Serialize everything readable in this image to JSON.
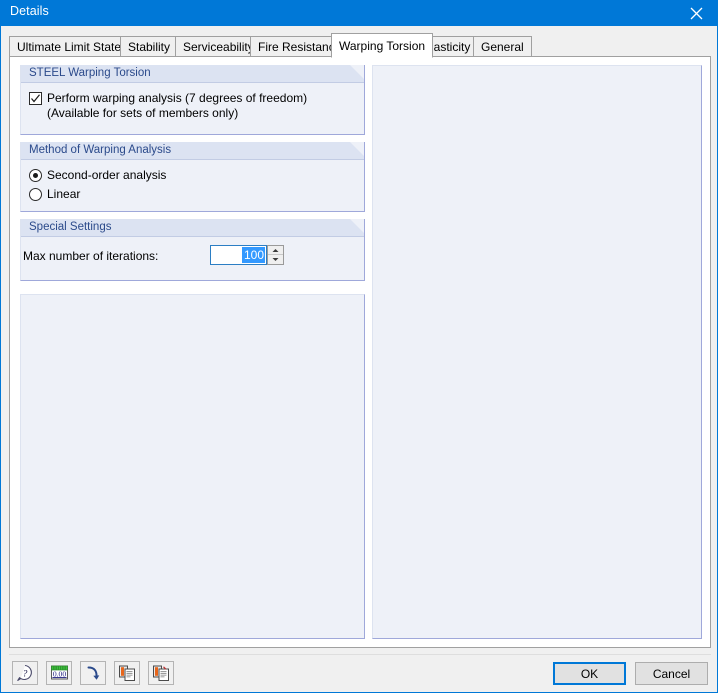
{
  "window": {
    "title": "Details",
    "close_icon": "close-icon",
    "accent_color": "#0078d7"
  },
  "tabs": [
    {
      "label": "Ultimate Limit State",
      "active": false
    },
    {
      "label": "Stability",
      "active": false
    },
    {
      "label": "Serviceability",
      "active": false
    },
    {
      "label": "Fire Resistance",
      "active": false
    },
    {
      "label": "Warping Torsion",
      "active": true
    },
    {
      "label": "Plasticity",
      "active": false
    },
    {
      "label": "General",
      "active": false
    }
  ],
  "groups": {
    "warping_torsion": {
      "title": "STEEL Warping Torsion",
      "checkbox": {
        "label_line1": "Perform warping analysis (7 degrees of freedom)",
        "label_line2": "(Available for sets of members only)",
        "checked": true
      }
    },
    "method": {
      "title": "Method of Warping Analysis",
      "options": [
        {
          "label": "Second-order analysis",
          "selected": true
        },
        {
          "label": "Linear",
          "selected": false
        }
      ]
    },
    "special": {
      "title": "Special Settings",
      "field_label": "Max number of iterations:",
      "field_value": "100",
      "field_selected": true,
      "spinner_up_icon": "chevron-up-icon",
      "spinner_down_icon": "chevron-down-icon"
    }
  },
  "toolbar": {
    "buttons": [
      {
        "name": "help-icon",
        "tip": "Help"
      },
      {
        "name": "number-format-icon",
        "tip": "Units and Decimal Places"
      },
      {
        "name": "undo-arrow-icon",
        "tip": "Restore Default Settings"
      },
      {
        "name": "copy-settings-icon",
        "tip": "Copy Settings"
      },
      {
        "name": "paste-settings-icon",
        "tip": "Paste Settings"
      }
    ]
  },
  "footer": {
    "ok_label": "OK",
    "cancel_label": "Cancel",
    "ok_is_default": true
  }
}
